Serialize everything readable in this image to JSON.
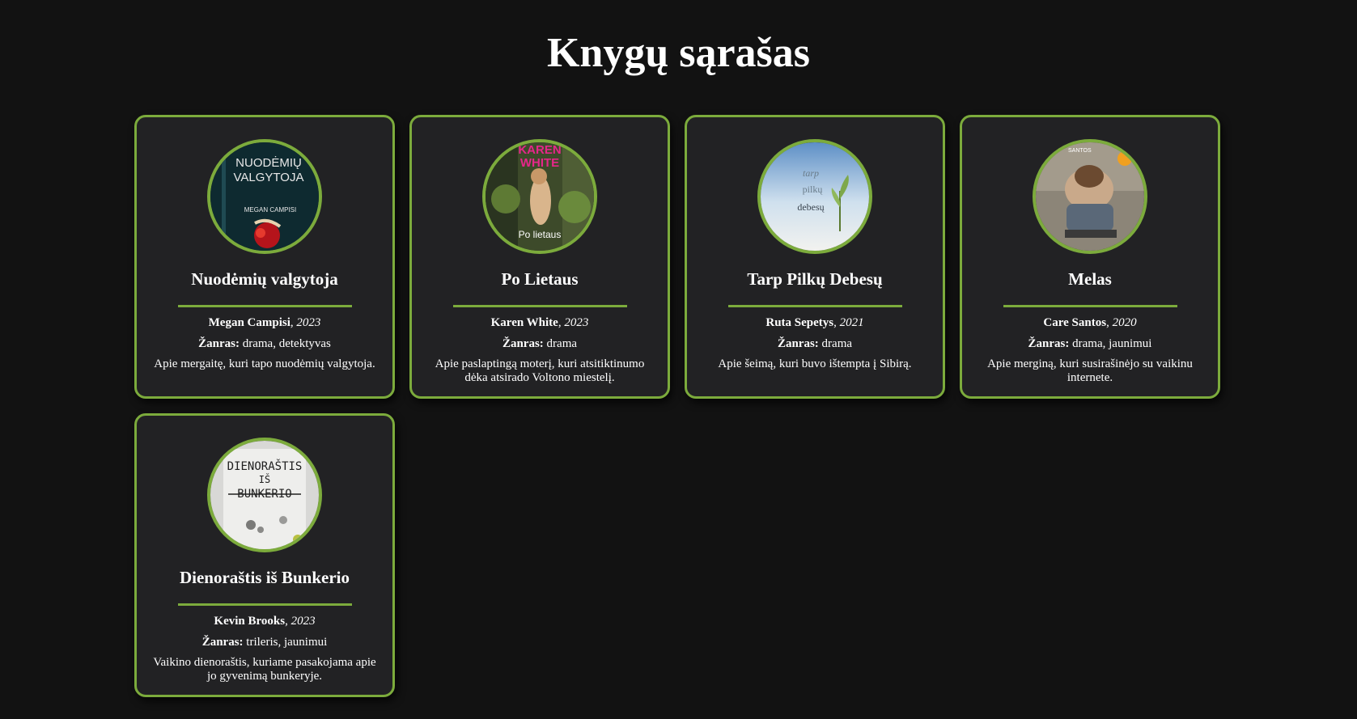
{
  "page": {
    "title": "Knygų sąrašas"
  },
  "labels": {
    "genre": "Žanras:"
  },
  "colors": {
    "background": "#121212",
    "card": "#222224",
    "accent": "#7cab3c",
    "text": "#ffffff"
  },
  "books": [
    {
      "title": "Nuodėmių valgytoja",
      "author": "Megan Campisi",
      "year": "2023",
      "genre": "drama, detektyvas",
      "description": "Apie mergaitę, kuri tapo nuodėmių valgytoja.",
      "cover": {
        "icon": "book-cover-dark-pomegranate",
        "text_line1": "NUODĖMIŲ",
        "text_line2": "VALGYTOJA",
        "text_author": "MEGAN CAMPISI"
      }
    },
    {
      "title": "Po Lietaus",
      "author": "Karen White",
      "year": "2023",
      "genre": "drama",
      "description": "Apie paslaptingą moterį, kuri atsitiktinumo dėka atsirado Voltono miestelį.",
      "cover": {
        "icon": "book-cover-woman-leaves",
        "text_line1": "KAREN",
        "text_line2": "WHITE",
        "text_bottom": "Po lietaus"
      }
    },
    {
      "title": "Tarp Pilkų Debesų",
      "author": "Ruta Sepetys",
      "year": "2021",
      "genre": "drama",
      "description": "Apie šeimą, kuri buvo ištempta į Sibirą.",
      "cover": {
        "icon": "book-cover-sky-sprout",
        "text_line1": "tarp",
        "text_line2": "pilkų",
        "text_line3": "debesų"
      }
    },
    {
      "title": "Melas",
      "author": "Care Santos",
      "year": "2020",
      "genre": "drama, jaunimui",
      "description": "Apie merginą, kuri susirašinėjo su vaikinu internete.",
      "cover": {
        "icon": "book-cover-sitting-boy",
        "text_top": "SANTOS"
      }
    },
    {
      "title": "Dienoraštis iš Bunkerio",
      "author": "Kevin Brooks",
      "year": "2023",
      "genre": "trileris, jaunimui",
      "description": "Vaikino dienoraštis, kuriame pasakojama apie jo gyvenimą bunkeryje.",
      "cover": {
        "icon": "book-cover-handwritten-paper",
        "text_line1": "DIENORAŠTIS",
        "text_line2": "IŠ",
        "text_line3": "BUNKERIO"
      }
    }
  ]
}
